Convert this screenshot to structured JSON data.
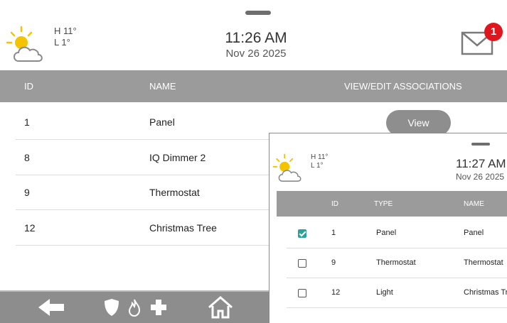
{
  "main": {
    "weather": {
      "icon": "partly-sunny-icon",
      "high": "H 11°",
      "low": "L 1°"
    },
    "clock": {
      "time": "11:26 AM",
      "date": "Nov 26 2025"
    },
    "messages": {
      "icon": "mail-icon",
      "badge_count": "1",
      "badge_color": "#e0161f"
    },
    "table": {
      "headers": {
        "id": "ID",
        "name": "NAME",
        "associations": "VIEW/EDIT ASSOCIATIONS"
      },
      "rows": [
        {
          "id": "1",
          "name": "Panel",
          "action": "View"
        },
        {
          "id": "8",
          "name": "IQ Dimmer 2"
        },
        {
          "id": "9",
          "name": "Thermostat"
        },
        {
          "id": "12",
          "name": "Christmas Tree"
        }
      ]
    },
    "navbar": {
      "items": [
        "back-arrow-icon",
        "security-shield-icon",
        "fire-icon",
        "medical-cross-icon",
        "home-icon"
      ]
    }
  },
  "overlay": {
    "weather": {
      "icon": "partly-sunny-icon",
      "high": "H 11°",
      "low": "L 1°"
    },
    "clock": {
      "time": "11:27 AM",
      "date": "Nov 26 2025"
    },
    "table": {
      "headers": {
        "id": "ID",
        "type": "TYPE",
        "name": "NAME"
      },
      "rows": [
        {
          "checked": true,
          "id": "1",
          "type": "Panel",
          "name": "Panel"
        },
        {
          "checked": false,
          "id": "9",
          "type": "Thermostat",
          "name": "Thermostat"
        },
        {
          "checked": false,
          "id": "12",
          "type": "Light",
          "name": "Christmas Tree"
        }
      ]
    },
    "accent": "#2aa39a"
  }
}
